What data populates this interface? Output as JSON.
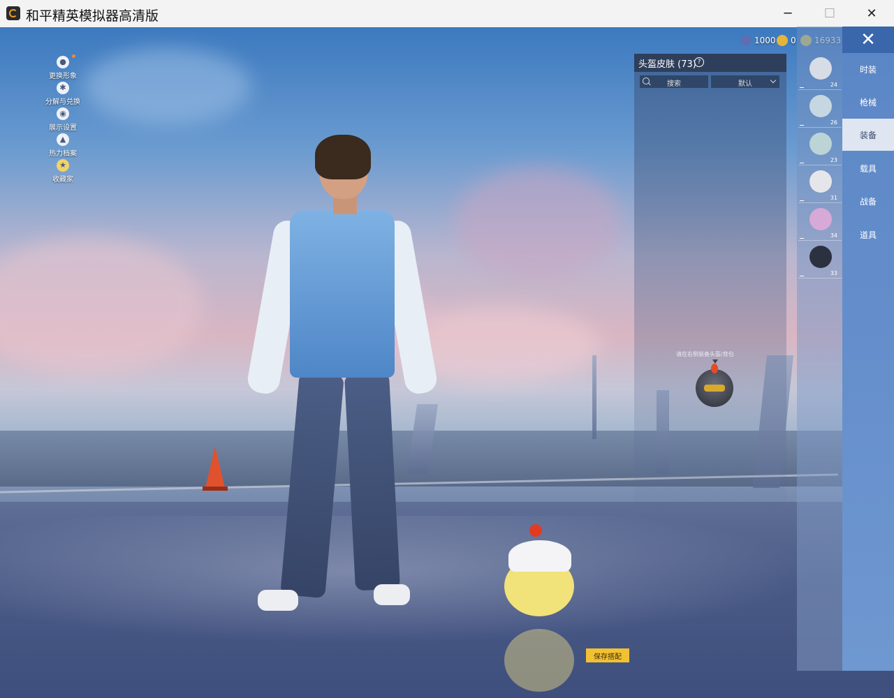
{
  "window": {
    "title": "和平精英模拟器高清版",
    "minimize_glyph": "─",
    "maximize_glyph": "☐",
    "close_glyph": "✕"
  },
  "left_menu": [
    {
      "label": "更换形象",
      "icon": "person-icon"
    },
    {
      "label": "分解与兑换",
      "icon": "gear-icon"
    },
    {
      "label": "展示设置",
      "icon": "eye-icon"
    },
    {
      "label": "热力档案",
      "icon": "flame-icon"
    },
    {
      "label": "收藏家",
      "icon": "badge-icon"
    }
  ],
  "currency": [
    {
      "value": "1000",
      "icon": "sphere-coin-icon",
      "color": "#5b6fb5"
    },
    {
      "value": "0",
      "icon": "gold-coin-icon",
      "color": "#e4b53a"
    },
    {
      "value": "16933",
      "icon": "token-coin-icon",
      "color": "#d8c85a"
    }
  ],
  "skin_panel": {
    "title": "头盔皮肤 (73)",
    "help_glyph": "?",
    "search_label": "搜索",
    "sort_label": "默认",
    "hint": "请在右侧装备头盔/背包"
  },
  "items": [
    {
      "count": "24",
      "color": "#d8dce6"
    },
    {
      "count": "26",
      "color": "#c7d7e2"
    },
    {
      "count": "23",
      "color": "#bcd4d6"
    },
    {
      "count": "31",
      "color": "#e6e6ea"
    },
    {
      "count": "34",
      "color": "#d7a9d6"
    },
    {
      "count": "33",
      "color": "#2c3140"
    }
  ],
  "categories": [
    {
      "label": "时装",
      "active": false
    },
    {
      "label": "枪械",
      "active": false
    },
    {
      "label": "装备",
      "active": true
    },
    {
      "label": "载具",
      "active": false
    },
    {
      "label": "战备",
      "active": false
    },
    {
      "label": "道具",
      "active": false
    }
  ],
  "close_panel_glyph": "✕",
  "save_button": "保存搭配",
  "colors": {
    "accent": "#f2c131",
    "tab_active": "#dfe6f1",
    "tab_bar": "#5b86c6"
  }
}
